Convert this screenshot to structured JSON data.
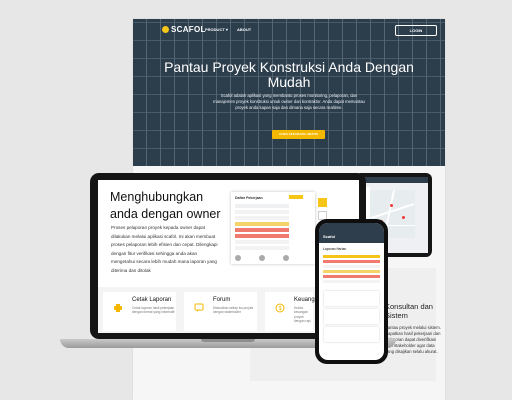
{
  "site": {
    "logo": "SCAFOL",
    "nav": [
      "PRODUCT ▾",
      "ABOUT"
    ],
    "login": "LOGIN",
    "hero_title": "Pantau Proyek Konstruksi Anda Dengan Mudah",
    "hero_desc": "Scafol adalah aplikasi yang membantu proses monitoring, pelaporan, dan manajemen proyek konstruksi untuk owner dan kontraktor. Anda dapat memantau proyek anda kapan saja dan dimana saja secara realtime.",
    "cta": "COBA SEKARANG GRATIS",
    "side_card_title": "Konsultan dan Sistem",
    "side_card_desc": "Pantau proyek melalui sistem. Dapatkan hasil pekerjaan dan pelaporan dapat diverifikasi oleh stakeholder agar data yang disajikan selalu akurat."
  },
  "laptop": {
    "slide_title": "Menghubungkan anda dengan owner",
    "slide_desc": "Proses pelaporan proyek kepada owner dapat dilakukan melalui aplikasi scafol. Ini akan membuat proses pelaporan lebih efisien dan cepat. Dilengkapi dengan fitur verifikasi sehingga anda akan mengetahui secara lebih mudah mana laporan yang diterima dan ditolak",
    "panel_title": "Daftar Pekerjaan",
    "features": [
      {
        "title": "Cetak Laporan",
        "desc": "Cetak laporan hasil pekerjaan dengan format yang informatif",
        "icon": "printer-icon"
      },
      {
        "title": "Forum",
        "desc": "Diskusikan setiap isu proyek dengan stakeholder",
        "icon": "chat-icon"
      },
      {
        "title": "Keuangan",
        "desc": "Kelola keuangan proyek dengan rapi",
        "icon": "money-icon"
      }
    ]
  },
  "phone": {
    "logo": "Scafol",
    "subtitle": "Laporan Harian"
  },
  "colors": {
    "accent": "#f5c518",
    "hero": "#2c3d4c",
    "danger": "#ef3b3b"
  }
}
